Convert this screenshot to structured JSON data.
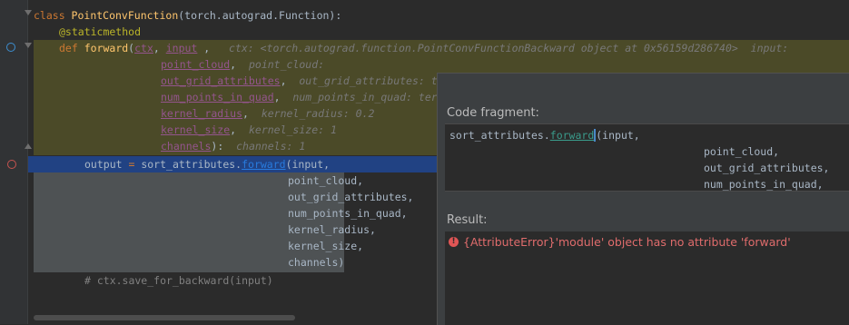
{
  "editor": {
    "line1": {
      "kw": "class ",
      "name": "PointConvFunction",
      "rest": "(torch.autograd.Function):"
    },
    "line2": {
      "decorator": "@staticmethod"
    },
    "line3": {
      "kw": "def ",
      "name": "forward",
      "open": "(",
      "p1": "ctx",
      "comma1": ", ",
      "p2": "input",
      "comma2": " , ",
      "hint": "ctx: <torch.autograd.function.PointConvFunctionBackward object at 0x56159d286740>  input:"
    },
    "line4": {
      "param": "point_cloud",
      "comma": ",",
      "hint": "point_cloud:"
    },
    "line5": {
      "param": "out_grid_attributes",
      "comma": ",",
      "hint": "out_grid_attributes: t"
    },
    "line6": {
      "param": "num_points_in_quad",
      "comma": ",",
      "hint": "num_points_in_quad: ter"
    },
    "line7": {
      "param": "kernel_radius",
      "comma": ",",
      "hint": "kernel_radius: 0.2"
    },
    "line8": {
      "param": "kernel_size",
      "comma": ",",
      "hint": "kernel_size: 1"
    },
    "line9": {
      "param": "channels",
      "close": "):",
      "hint": "channels: 1"
    },
    "line10": {
      "var": "output",
      "eq": " = ",
      "obj": "sort_attributes.",
      "method": "forward",
      "arg": "(input,"
    },
    "args": [
      "point_cloud,",
      "out_grid_attributes,",
      "num_points_in_quad,",
      "kernel_radius,",
      "kernel_size,",
      "channels)"
    ],
    "comment": "# ctx.save_for_backward(input)"
  },
  "popup": {
    "fragment_label": "Code fragment:",
    "fragment": {
      "obj": "sort_attributes.",
      "method": "forward",
      "rest": "(input,",
      "args": [
        "point_cloud,",
        "out_grid_attributes,",
        "num_points_in_quad,"
      ]
    },
    "result_label": "Result:",
    "error_icon": "!",
    "error_text": "{AttributeError}'module' object has no attribute 'forward'"
  },
  "colors": {
    "background": "#2b2b2b",
    "gutter": "#313335",
    "execution_highlight": "#4b4a28",
    "selection": "#214283",
    "current_line_gray": "#4e5254",
    "error": "#e06c6c"
  }
}
